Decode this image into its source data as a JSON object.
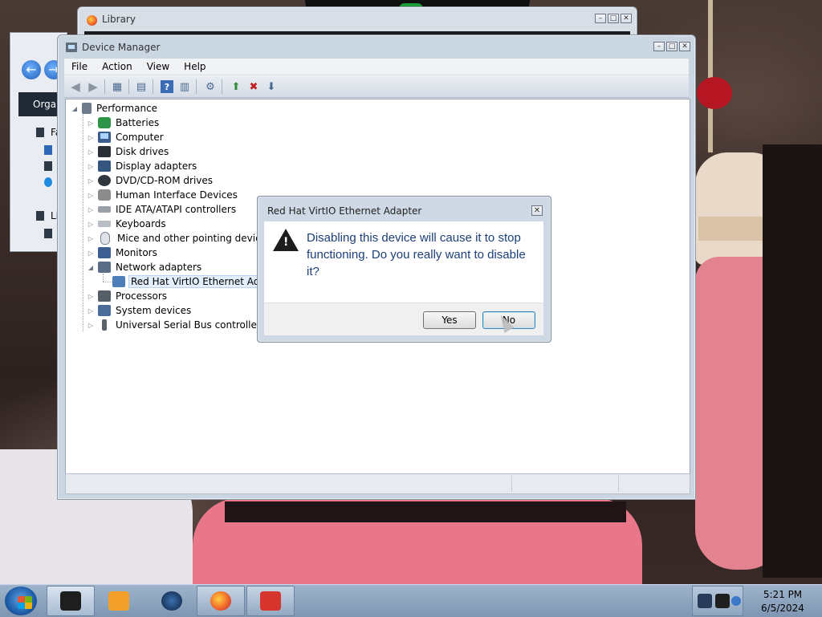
{
  "library_window": {
    "title": "Library"
  },
  "explorer_window": {
    "organize_label": "Organ",
    "side_items": [
      "Fa",
      "Li"
    ]
  },
  "device_manager": {
    "title": "Device Manager",
    "menu": [
      "File",
      "Action",
      "View",
      "Help"
    ],
    "tree": {
      "root": "Performance",
      "categories": [
        "Batteries",
        "Computer",
        "Disk drives",
        "Display adapters",
        "DVD/CD-ROM drives",
        "Human Interface Devices",
        "IDE ATA/ATAPI controllers",
        "Keyboards",
        "Mice and other pointing devices",
        "Monitors",
        "Network adapters",
        "Processors",
        "System devices",
        "Universal Serial Bus controllers"
      ],
      "network_child": "Red Hat VirtIO Ethernet Adapt"
    }
  },
  "dialog": {
    "title": "Red Hat VirtIO Ethernet Adapter",
    "message": "Disabling this device will cause it to stop functioning. Do you really want to disable it?",
    "yes_label": "Yes",
    "no_label": "No"
  },
  "taskbar": {
    "time": "5:21 PM",
    "date": "6/5/2024"
  },
  "colors": {
    "accent": "#1b3f7a",
    "selection": "#e3eefb",
    "taskbar": "#8fa6c0"
  }
}
